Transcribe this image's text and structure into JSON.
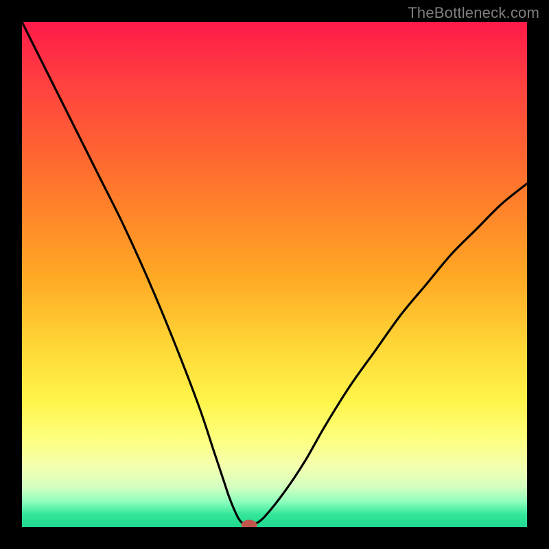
{
  "watermark": "TheBottleneck.com",
  "colors": {
    "frame": "#000000",
    "curve_stroke": "#000000",
    "marker_fill": "#c0564c",
    "marker_stroke": "#c0564c",
    "watermark": "#7f7f7f"
  },
  "chart_data": {
    "type": "line",
    "title": "",
    "xlabel": "",
    "ylabel": "",
    "xlim": [
      0,
      100
    ],
    "ylim": [
      0,
      100
    ],
    "grid": false,
    "legend": false,
    "annotations": [
      "TheBottleneck.com"
    ],
    "series": [
      {
        "name": "bottleneck-curve",
        "x": [
          0,
          5,
          10,
          15,
          20,
          25,
          30,
          35,
          38,
          40,
          41,
          42,
          43,
          44,
          45,
          46,
          48,
          52,
          56,
          60,
          65,
          70,
          75,
          80,
          85,
          90,
          95,
          100
        ],
        "y": [
          100,
          90,
          80,
          70,
          60,
          49,
          37,
          24,
          15,
          9,
          6,
          3.5,
          1.5,
          0.5,
          0,
          0.5,
          2,
          7,
          13,
          20,
          28,
          35,
          42,
          48,
          54,
          59,
          64,
          68
        ]
      }
    ],
    "marker": {
      "x": 45,
      "y": 0
    }
  }
}
